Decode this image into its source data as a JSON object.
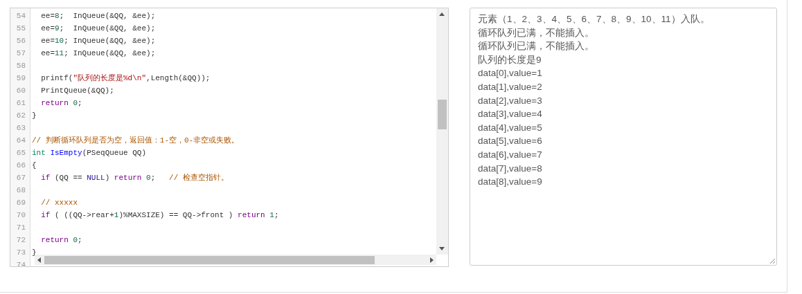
{
  "editor": {
    "lines": [
      {
        "number": "54",
        "tokens": [
          {
            "kind": "plain",
            "text": "  ee="
          },
          {
            "kind": "number",
            "text": "8"
          },
          {
            "kind": "plain",
            "text": ";  InQueue(&QQ, &ee);"
          }
        ]
      },
      {
        "number": "55",
        "tokens": [
          {
            "kind": "plain",
            "text": "  ee="
          },
          {
            "kind": "number",
            "text": "9"
          },
          {
            "kind": "plain",
            "text": ";  InQueue(&QQ, &ee);"
          }
        ]
      },
      {
        "number": "56",
        "tokens": [
          {
            "kind": "plain",
            "text": "  ee="
          },
          {
            "kind": "number",
            "text": "10"
          },
          {
            "kind": "plain",
            "text": "; InQueue(&QQ, &ee);"
          }
        ]
      },
      {
        "number": "57",
        "tokens": [
          {
            "kind": "plain",
            "text": "  ee="
          },
          {
            "kind": "number",
            "text": "11"
          },
          {
            "kind": "plain",
            "text": "; InQueue(&QQ, &ee);"
          }
        ]
      },
      {
        "number": "58"
      },
      {
        "number": "59",
        "tokens": [
          {
            "kind": "plain",
            "text": "  printf("
          },
          {
            "kind": "string",
            "text": "\"队列的长度是%d\\n\""
          },
          {
            "kind": "plain",
            "text": ",Length(&QQ));"
          }
        ]
      },
      {
        "number": "60",
        "tokens": [
          {
            "kind": "plain",
            "text": "  PrintQueue(&QQ);"
          }
        ]
      },
      {
        "number": "61",
        "tokens": [
          {
            "kind": "keyword",
            "text": "  return"
          },
          {
            "kind": "number",
            "text": " 0"
          },
          {
            "kind": "plain",
            "text": ";"
          }
        ]
      },
      {
        "number": "62",
        "tokens": [
          {
            "kind": "plain",
            "text": "}"
          }
        ]
      },
      {
        "number": "63"
      },
      {
        "number": "64",
        "tokens": [
          {
            "kind": "comment",
            "text": "// 判断循环队列是否为空，返回值：1-空，0-非空或失败。"
          }
        ]
      },
      {
        "number": "65",
        "tokens": [
          {
            "kind": "type",
            "text": "int"
          },
          {
            "kind": "function",
            "text": " IsEmpty"
          },
          {
            "kind": "plain",
            "text": "(PSeqQueue QQ)"
          }
        ]
      },
      {
        "number": "66",
        "tokens": [
          {
            "kind": "plain",
            "text": "{"
          }
        ]
      },
      {
        "number": "67",
        "tokens": [
          {
            "kind": "keyword",
            "text": "  if"
          },
          {
            "kind": "plain",
            "text": " (QQ == "
          },
          {
            "kind": "constant",
            "text": "NULL"
          },
          {
            "kind": "plain",
            "text": ") "
          },
          {
            "kind": "keyword",
            "text": "return"
          },
          {
            "kind": "number",
            "text": " 0"
          },
          {
            "kind": "plain",
            "text": ";   "
          },
          {
            "kind": "comment",
            "text": "// 检查空指针。"
          }
        ]
      },
      {
        "number": "68"
      },
      {
        "number": "69",
        "tokens": [
          {
            "kind": "comment",
            "text": "  // xxxxx"
          }
        ]
      },
      {
        "number": "70",
        "tokens": [
          {
            "kind": "keyword",
            "text": "  if"
          },
          {
            "kind": "plain",
            "text": " ( ((QQ->rear+"
          },
          {
            "kind": "number",
            "text": "1"
          },
          {
            "kind": "plain",
            "text": ")%MAXSIZE) == QQ->front ) "
          },
          {
            "kind": "keyword",
            "text": "return"
          },
          {
            "kind": "number",
            "text": " 1"
          },
          {
            "kind": "plain",
            "text": ";"
          }
        ]
      },
      {
        "number": "71"
      },
      {
        "number": "72",
        "tokens": [
          {
            "kind": "keyword",
            "text": "  return"
          },
          {
            "kind": "number",
            "text": " 0"
          },
          {
            "kind": "plain",
            "text": ";"
          }
        ]
      },
      {
        "number": "73",
        "tokens": [
          {
            "kind": "plain",
            "text": "}"
          }
        ]
      },
      {
        "number": "74"
      }
    ]
  },
  "output": {
    "lines": [
      "元素（1、2、3、4、5、6、7、8、9、10、11）入队。",
      "循环队列已满，不能插入。",
      "循环队列已满，不能插入。",
      "队列的长度是9",
      "data[0],value=1",
      "data[1],value=2",
      "data[2],value=3",
      "data[3],value=4",
      "data[4],value=5",
      "data[5],value=6",
      "data[6],value=7",
      "data[7],value=8",
      "data[8],value=9"
    ]
  }
}
